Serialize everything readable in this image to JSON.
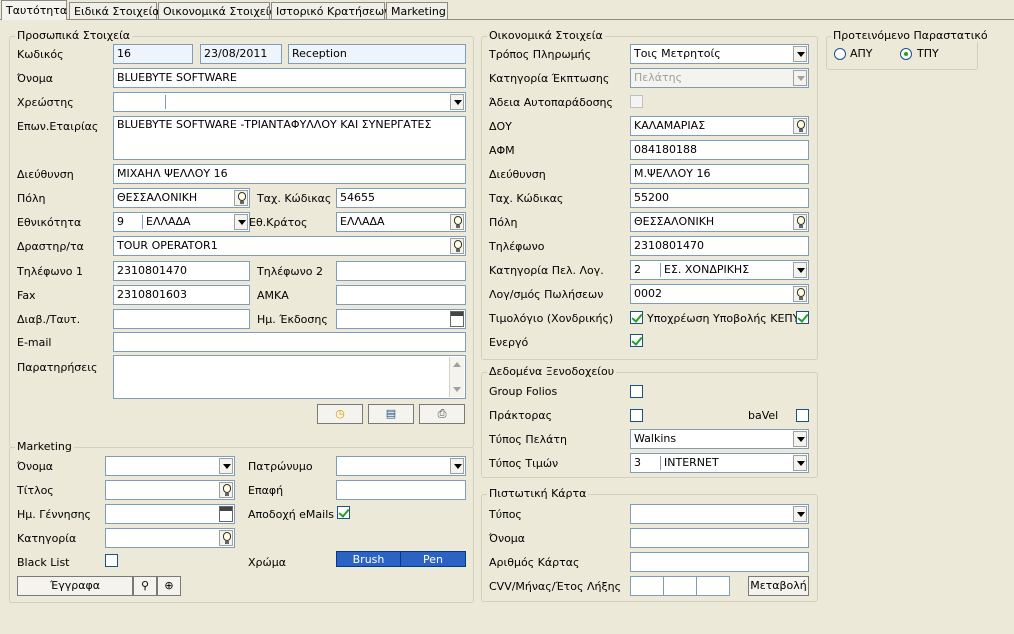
{
  "tabs": [
    "Ταυτότητα",
    "Ειδικά Στοιχεία",
    "Οικονομικά Στοιχεία",
    "Ιστορικό Κρατήσεων",
    "Marketing"
  ],
  "personal": {
    "title": "Προσωπικά Στοιχεία",
    "code_label": "Κωδικός",
    "code": "16",
    "date": "23/08/2011",
    "source": "Reception",
    "name_label": "Όνομα",
    "name": "BLUEBYTE SOFTWARE",
    "charge_label": "Χρεώστης",
    "charge": "",
    "company_label": "Επων.Εταιρίας",
    "company": "BLUEBYTE SOFTWARE -ΤΡΙΑΝΤΑΦΥΛΛΟΥ ΚΑΙ ΣΥΝΕΡΓΑΤΕΣ",
    "address_label": "Διεύθυνση",
    "address": "ΜΙΧΑΗΛ ΨΕΛΛΟΥ 16",
    "city_label": "Πόλη",
    "city": "ΘΕΣΣΑΛΟΝΙΚΗ",
    "zip_label": "Ταχ. Κώδικας",
    "zip": "54655",
    "nationality_label": "Εθνικότητα",
    "nationality_code": "9",
    "nationality": "ΕΛΛΑΔΑ",
    "state_label": "Εθ.Κράτος",
    "state": "ΕΛΛΑΔΑ",
    "activity_label": "Δραστηρ/τα",
    "activity": "TOUR OPERATOR1",
    "phone1_label": "Τηλέφωνο 1",
    "phone1": "2310801470",
    "phone2_label": "Τηλέφωνο 2",
    "phone2": "",
    "fax_label": "Fax",
    "fax": "2310801603",
    "amka_label": "ΑΜΚΑ",
    "amka": "",
    "passport_label": "Διαβ./Ταυτ.",
    "passport": "",
    "issue_label": "Ημ. Έκδοσης",
    "issue": "",
    "email_label": "E-mail",
    "email": "",
    "notes_label": "Παρατηρήσεις",
    "notes": ""
  },
  "marketing": {
    "title": "Marketing",
    "name_label": "Όνομα",
    "name": "",
    "father_label": "Πατρώνυμο",
    "father": "",
    "title_label": "Τίτλος",
    "title_value": "",
    "contact_label": "Επαφή",
    "contact": "",
    "birth_label": "Ημ. Γέννησης",
    "birth": "",
    "accept_label": "Αποδοχή eMails",
    "accept_checked": true,
    "category_label": "Κατηγορία",
    "category": "",
    "blacklist_label": "Black List",
    "blacklist_checked": false,
    "color_label": "Χρώμα",
    "brush": "Brush",
    "pen": "Pen",
    "documents": "Έγγραφα"
  },
  "financial": {
    "title": "Οικονομικά Στοιχεία",
    "payment_label": "Τρόπος Πληρωμής",
    "payment": "Τοις Μετρητοίς",
    "discount_label": "Κατηγορία Έκπτωσης",
    "discount": "Πελάτης",
    "selfbilling_label": "Άδεια Αυτοπαράδοσης",
    "selfbilling_checked": false,
    "doy_label": "ΔΟΥ",
    "doy": "ΚΑΛΑΜΑΡΙΑΣ",
    "afm_label": "ΑΦΜ",
    "afm": "084180188",
    "address_label": "Διεύθυνση",
    "address": "Μ.ΨΕΛΛΟΥ 16",
    "zip_label": "Ταχ. Κώδικας",
    "zip": "55200",
    "city_label": "Πόλη",
    "city": "ΘΕΣΣΑΛΟΝΙΚΗ",
    "phone_label": "Τηλέφωνο",
    "phone": "2310801470",
    "category_label": "Κατηγορία Πελ. Λογ.",
    "category_code": "2",
    "category": "ΕΣ. ΧΟΝΔΡΙΚΗΣ",
    "sales_label": "Λογ/σμός Πωλήσεων",
    "sales": "0002",
    "invoice_label": "Τιμολόγιο (Χονδρικής)",
    "invoice_checked": true,
    "kepyo_label": "Υποχρέωση Υποβολής ΚΕΠΥΟ",
    "kepyo_checked": true,
    "active_label": "Ενεργό",
    "active_checked": true
  },
  "preferred": {
    "title": "Προτεινόμενο Παραστατικό",
    "apy": "ΑΠΥ",
    "tpy": "ΤΠΥ",
    "selected": "ΤΠΥ"
  },
  "hotel": {
    "title": "Δεδομένα Ξενοδοχείου",
    "folios_label": "Group Folios",
    "folios_checked": false,
    "agent_label": "Πράκτορας",
    "agent_checked": false,
    "bavel_label": "baVel",
    "bavel_checked": false,
    "customer_type_label": "Τύπος Πελάτη",
    "customer_type": "Walkins",
    "price_type_label": "Τύπος Τιμών",
    "price_type_code": "3",
    "price_type": "INTERNET"
  },
  "card": {
    "title": "Πιστωτική Κάρτα",
    "type_label": "Τύπος",
    "type": "",
    "name_label": "Όνομα",
    "name": "",
    "number_label": "Αριθμός Κάρτας",
    "number": "",
    "cvv_label": "CVV/Μήνας/Έτος Λήξης",
    "change_button": "Μεταβολή"
  }
}
